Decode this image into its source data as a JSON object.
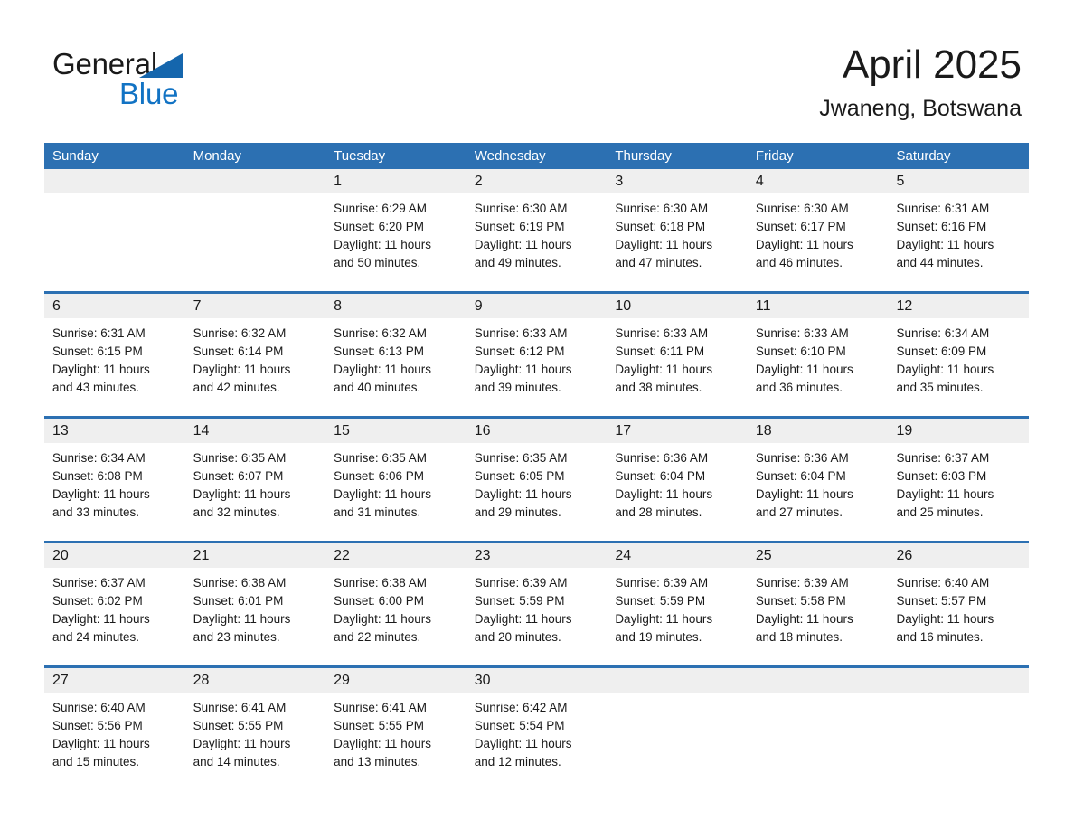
{
  "brand": {
    "name_part1": "General",
    "name_part2": "Blue",
    "triangle_color": "#1566ad",
    "blue_color": "#1273c4"
  },
  "header": {
    "month_title": "April 2025",
    "location": "Jwaneng, Botswana"
  },
  "theme": {
    "header_blue": "#2c70b2",
    "daynum_band": "#efefef",
    "text": "#1a1a1a"
  },
  "weekdays": [
    "Sunday",
    "Monday",
    "Tuesday",
    "Wednesday",
    "Thursday",
    "Friday",
    "Saturday"
  ],
  "weeks": [
    {
      "days": [
        {
          "num": "",
          "empty": true
        },
        {
          "num": "",
          "empty": true
        },
        {
          "num": "1",
          "sunrise": "Sunrise: 6:29 AM",
          "sunset": "Sunset: 6:20 PM",
          "daylight1": "Daylight: 11 hours",
          "daylight2": "and 50 minutes."
        },
        {
          "num": "2",
          "sunrise": "Sunrise: 6:30 AM",
          "sunset": "Sunset: 6:19 PM",
          "daylight1": "Daylight: 11 hours",
          "daylight2": "and 49 minutes."
        },
        {
          "num": "3",
          "sunrise": "Sunrise: 6:30 AM",
          "sunset": "Sunset: 6:18 PM",
          "daylight1": "Daylight: 11 hours",
          "daylight2": "and 47 minutes."
        },
        {
          "num": "4",
          "sunrise": "Sunrise: 6:30 AM",
          "sunset": "Sunset: 6:17 PM",
          "daylight1": "Daylight: 11 hours",
          "daylight2": "and 46 minutes."
        },
        {
          "num": "5",
          "sunrise": "Sunrise: 6:31 AM",
          "sunset": "Sunset: 6:16 PM",
          "daylight1": "Daylight: 11 hours",
          "daylight2": "and 44 minutes."
        }
      ]
    },
    {
      "days": [
        {
          "num": "6",
          "sunrise": "Sunrise: 6:31 AM",
          "sunset": "Sunset: 6:15 PM",
          "daylight1": "Daylight: 11 hours",
          "daylight2": "and 43 minutes."
        },
        {
          "num": "7",
          "sunrise": "Sunrise: 6:32 AM",
          "sunset": "Sunset: 6:14 PM",
          "daylight1": "Daylight: 11 hours",
          "daylight2": "and 42 minutes."
        },
        {
          "num": "8",
          "sunrise": "Sunrise: 6:32 AM",
          "sunset": "Sunset: 6:13 PM",
          "daylight1": "Daylight: 11 hours",
          "daylight2": "and 40 minutes."
        },
        {
          "num": "9",
          "sunrise": "Sunrise: 6:33 AM",
          "sunset": "Sunset: 6:12 PM",
          "daylight1": "Daylight: 11 hours",
          "daylight2": "and 39 minutes."
        },
        {
          "num": "10",
          "sunrise": "Sunrise: 6:33 AM",
          "sunset": "Sunset: 6:11 PM",
          "daylight1": "Daylight: 11 hours",
          "daylight2": "and 38 minutes."
        },
        {
          "num": "11",
          "sunrise": "Sunrise: 6:33 AM",
          "sunset": "Sunset: 6:10 PM",
          "daylight1": "Daylight: 11 hours",
          "daylight2": "and 36 minutes."
        },
        {
          "num": "12",
          "sunrise": "Sunrise: 6:34 AM",
          "sunset": "Sunset: 6:09 PM",
          "daylight1": "Daylight: 11 hours",
          "daylight2": "and 35 minutes."
        }
      ]
    },
    {
      "days": [
        {
          "num": "13",
          "sunrise": "Sunrise: 6:34 AM",
          "sunset": "Sunset: 6:08 PM",
          "daylight1": "Daylight: 11 hours",
          "daylight2": "and 33 minutes."
        },
        {
          "num": "14",
          "sunrise": "Sunrise: 6:35 AM",
          "sunset": "Sunset: 6:07 PM",
          "daylight1": "Daylight: 11 hours",
          "daylight2": "and 32 minutes."
        },
        {
          "num": "15",
          "sunrise": "Sunrise: 6:35 AM",
          "sunset": "Sunset: 6:06 PM",
          "daylight1": "Daylight: 11 hours",
          "daylight2": "and 31 minutes."
        },
        {
          "num": "16",
          "sunrise": "Sunrise: 6:35 AM",
          "sunset": "Sunset: 6:05 PM",
          "daylight1": "Daylight: 11 hours",
          "daylight2": "and 29 minutes."
        },
        {
          "num": "17",
          "sunrise": "Sunrise: 6:36 AM",
          "sunset": "Sunset: 6:04 PM",
          "daylight1": "Daylight: 11 hours",
          "daylight2": "and 28 minutes."
        },
        {
          "num": "18",
          "sunrise": "Sunrise: 6:36 AM",
          "sunset": "Sunset: 6:04 PM",
          "daylight1": "Daylight: 11 hours",
          "daylight2": "and 27 minutes."
        },
        {
          "num": "19",
          "sunrise": "Sunrise: 6:37 AM",
          "sunset": "Sunset: 6:03 PM",
          "daylight1": "Daylight: 11 hours",
          "daylight2": "and 25 minutes."
        }
      ]
    },
    {
      "days": [
        {
          "num": "20",
          "sunrise": "Sunrise: 6:37 AM",
          "sunset": "Sunset: 6:02 PM",
          "daylight1": "Daylight: 11 hours",
          "daylight2": "and 24 minutes."
        },
        {
          "num": "21",
          "sunrise": "Sunrise: 6:38 AM",
          "sunset": "Sunset: 6:01 PM",
          "daylight1": "Daylight: 11 hours",
          "daylight2": "and 23 minutes."
        },
        {
          "num": "22",
          "sunrise": "Sunrise: 6:38 AM",
          "sunset": "Sunset: 6:00 PM",
          "daylight1": "Daylight: 11 hours",
          "daylight2": "and 22 minutes."
        },
        {
          "num": "23",
          "sunrise": "Sunrise: 6:39 AM",
          "sunset": "Sunset: 5:59 PM",
          "daylight1": "Daylight: 11 hours",
          "daylight2": "and 20 minutes."
        },
        {
          "num": "24",
          "sunrise": "Sunrise: 6:39 AM",
          "sunset": "Sunset: 5:59 PM",
          "daylight1": "Daylight: 11 hours",
          "daylight2": "and 19 minutes."
        },
        {
          "num": "25",
          "sunrise": "Sunrise: 6:39 AM",
          "sunset": "Sunset: 5:58 PM",
          "daylight1": "Daylight: 11 hours",
          "daylight2": "and 18 minutes."
        },
        {
          "num": "26",
          "sunrise": "Sunrise: 6:40 AM",
          "sunset": "Sunset: 5:57 PM",
          "daylight1": "Daylight: 11 hours",
          "daylight2": "and 16 minutes."
        }
      ]
    },
    {
      "days": [
        {
          "num": "27",
          "sunrise": "Sunrise: 6:40 AM",
          "sunset": "Sunset: 5:56 PM",
          "daylight1": "Daylight: 11 hours",
          "daylight2": "and 15 minutes."
        },
        {
          "num": "28",
          "sunrise": "Sunrise: 6:41 AM",
          "sunset": "Sunset: 5:55 PM",
          "daylight1": "Daylight: 11 hours",
          "daylight2": "and 14 minutes."
        },
        {
          "num": "29",
          "sunrise": "Sunrise: 6:41 AM",
          "sunset": "Sunset: 5:55 PM",
          "daylight1": "Daylight: 11 hours",
          "daylight2": "and 13 minutes."
        },
        {
          "num": "30",
          "sunrise": "Sunrise: 6:42 AM",
          "sunset": "Sunset: 5:54 PM",
          "daylight1": "Daylight: 11 hours",
          "daylight2": "and 12 minutes."
        },
        {
          "num": "",
          "empty": true
        },
        {
          "num": "",
          "empty": true
        },
        {
          "num": "",
          "empty": true
        }
      ]
    }
  ]
}
